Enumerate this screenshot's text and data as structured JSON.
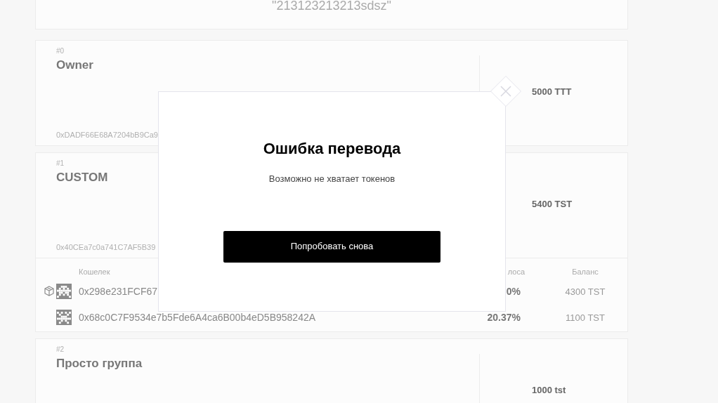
{
  "top_card": {
    "value": "\"213123213213sdsz\""
  },
  "groups": [
    {
      "index": "#0",
      "name": "Owner",
      "address": "0xDADF66E68A7204bB9Ca9",
      "balance": "5000 TTT"
    },
    {
      "index": "#1",
      "name": "CUSTOM",
      "address": "0x40CEa7c0a741C7AF5B39",
      "balance": "5400 TST",
      "members": {
        "columns": [
          "Кошелек",
          "лоса",
          "Баланс"
        ],
        "rows": [
          {
            "address": "0x298e231FCF67",
            "share": "0%",
            "balance": "4300 TST",
            "owner": true
          },
          {
            "address": "0x68c0C7F9534e7b5Fde6A4ca6B00b4eD5B958242A",
            "share": "20.37%",
            "balance": "1100 TST",
            "owner": false
          }
        ]
      }
    },
    {
      "index": "#2",
      "name": "Просто группа",
      "balance": "1000 tst"
    }
  ],
  "dialog": {
    "title": "Ошибка перевода",
    "message": "Возможно не хватает токенов",
    "button": "Попробовать снова"
  }
}
